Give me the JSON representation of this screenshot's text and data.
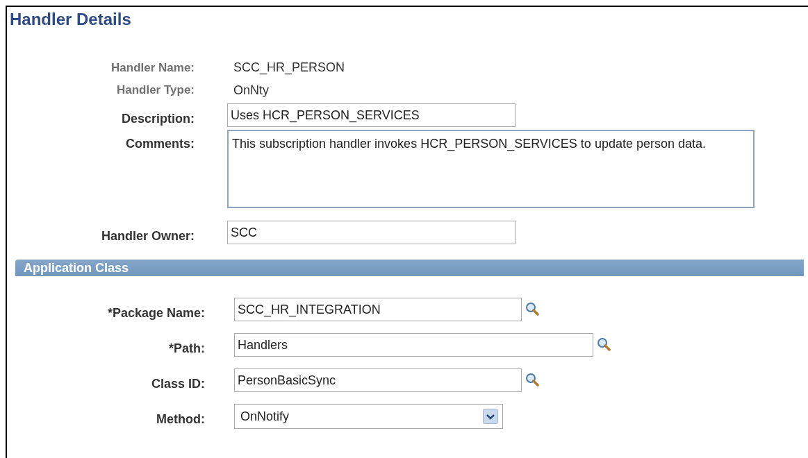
{
  "page_title": "Handler Details",
  "handler_fields": [
    {
      "kind": "display",
      "label": "Handler Name:",
      "value": "SCC_HR_PERSON"
    },
    {
      "kind": "display",
      "label": "Handler Type:",
      "value": "OnNty"
    },
    {
      "kind": "text",
      "label": "Description:",
      "value": "Uses HCR_PERSON_SERVICES"
    },
    {
      "kind": "textarea",
      "label": "Comments:",
      "value": "This subscription handler invokes HCR_PERSON_SERVICES to update person data."
    },
    {
      "kind": "text",
      "label": "Handler Owner:",
      "value": "SCC"
    }
  ],
  "section": {
    "title": "Application Class",
    "fields": [
      {
        "kind": "lookup",
        "label": "*Package Name:",
        "value": "SCC_HR_INTEGRATION"
      },
      {
        "kind": "lookup",
        "label": "*Path:",
        "value": "Handlers"
      },
      {
        "kind": "lookup",
        "label": "Class ID:",
        "value": "PersonBasicSync"
      },
      {
        "kind": "select",
        "label": "Method:",
        "value": "OnNotify"
      }
    ]
  }
}
